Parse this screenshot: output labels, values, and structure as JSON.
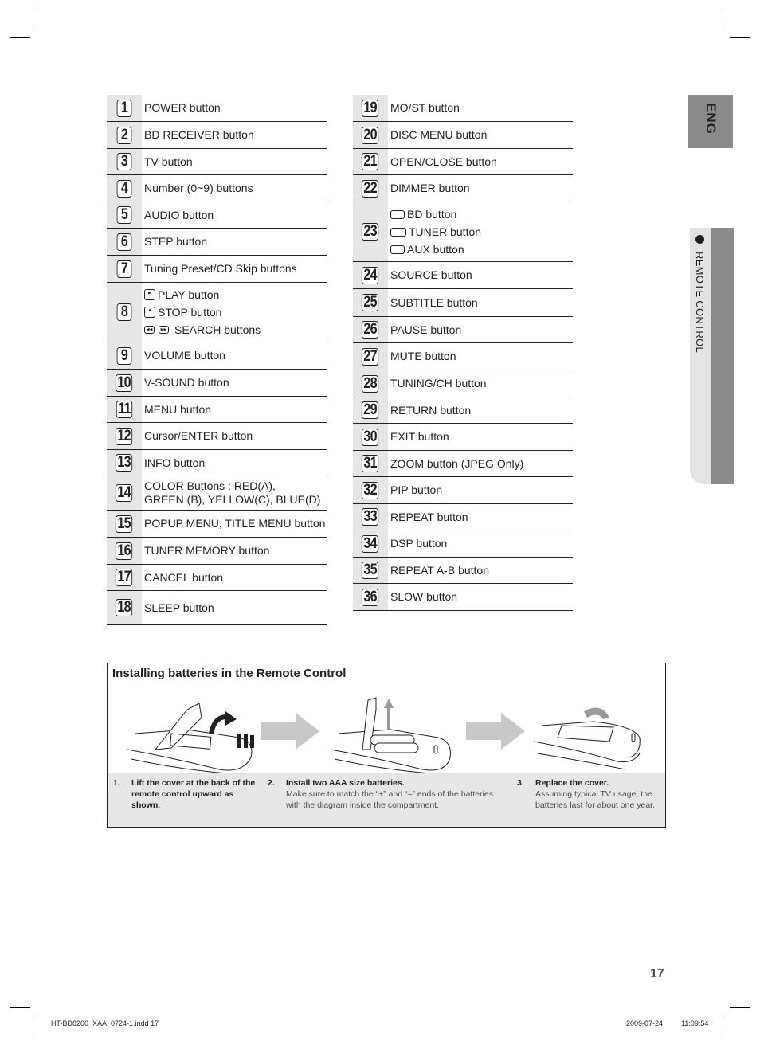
{
  "side_tabs": {
    "language": "ENG",
    "section": "REMOTE CONTROL"
  },
  "left_table": [
    {
      "num": "1",
      "lines": [
        "POWER button"
      ]
    },
    {
      "num": "2",
      "lines": [
        "BD RECEIVER button"
      ]
    },
    {
      "num": "3",
      "lines": [
        "TV button"
      ]
    },
    {
      "num": "4",
      "lines": [
        "Number (0~9) buttons"
      ]
    },
    {
      "num": "5",
      "lines": [
        "AUDIO button"
      ]
    },
    {
      "num": "6",
      "lines": [
        "STEP button"
      ]
    },
    {
      "num": "7",
      "lines": [
        "Tuning Preset/CD Skip buttons"
      ]
    },
    {
      "num": "8",
      "lines": [
        "PLAY button",
        "STOP button",
        "SEARCH buttons"
      ],
      "icons": [
        "play-icon",
        "stop-icon",
        "search-icon"
      ]
    },
    {
      "num": "9",
      "lines": [
        "VOLUME button"
      ]
    },
    {
      "num": "10",
      "lines": [
        "V-SOUND button"
      ]
    },
    {
      "num": "11",
      "lines": [
        "MENU button"
      ]
    },
    {
      "num": "12",
      "lines": [
        "Cursor/ENTER button"
      ]
    },
    {
      "num": "13",
      "lines": [
        "INFO button"
      ]
    },
    {
      "num": "14",
      "lines": [
        "COLOR Buttons : RED(A),",
        "GREEN (B), YELLOW(C), BLUE(D)"
      ]
    },
    {
      "num": "15",
      "lines": [
        "POPUP MENU, TITLE MENU button"
      ]
    },
    {
      "num": "16",
      "lines": [
        "TUNER MEMORY button"
      ]
    },
    {
      "num": "17",
      "lines": [
        "CANCEL button"
      ]
    },
    {
      "num": "18",
      "lines": [
        "SLEEP button"
      ]
    }
  ],
  "right_table": [
    {
      "num": "19",
      "lines": [
        "MO/ST button"
      ]
    },
    {
      "num": "20",
      "lines": [
        "DISC MENU button"
      ]
    },
    {
      "num": "21",
      "lines": [
        "OPEN/CLOSE button"
      ]
    },
    {
      "num": "22",
      "lines": [
        "DIMMER button"
      ]
    },
    {
      "num": "23",
      "lines": [
        "BD button",
        "TUNER button",
        "AUX button"
      ],
      "icons": [
        "bd-icon",
        "tuner-icon",
        "aux-icon"
      ]
    },
    {
      "num": "24",
      "lines": [
        "SOURCE button"
      ]
    },
    {
      "num": "25",
      "lines": [
        "SUBTITLE button"
      ]
    },
    {
      "num": "26",
      "lines": [
        "PAUSE button"
      ]
    },
    {
      "num": "27",
      "lines": [
        "MUTE button"
      ]
    },
    {
      "num": "28",
      "lines": [
        "TUNING/CH button"
      ]
    },
    {
      "num": "29",
      "lines": [
        "RETURN button"
      ]
    },
    {
      "num": "30",
      "lines": [
        "EXIT button"
      ]
    },
    {
      "num": "31",
      "lines": [
        "ZOOM button (JPEG Only)"
      ]
    },
    {
      "num": "32",
      "lines": [
        "PIP button"
      ]
    },
    {
      "num": "33",
      "lines": [
        "REPEAT button"
      ]
    },
    {
      "num": "34",
      "lines": [
        "DSP button"
      ]
    },
    {
      "num": "35",
      "lines": [
        "REPEAT A-B button"
      ]
    },
    {
      "num": "36",
      "lines": [
        "SLOW button"
      ]
    }
  ],
  "icon_labels": {
    "play": "PLAY",
    "stop": "STOP",
    "bd": "BD",
    "tuner": "TUNER",
    "aux": "AUX"
  },
  "batteries": {
    "title": "Installing batteries in the Remote Control",
    "steps": [
      {
        "n": "1.",
        "title": "Lift the cover at the back of the remote control upward as shown.",
        "desc": ""
      },
      {
        "n": "2.",
        "title": "Install two AAA size batteries.",
        "desc": "Make sure to match the “+” and “–” ends of the batteries with the diagram inside the compartment."
      },
      {
        "n": "3.",
        "title": "Replace the cover.",
        "desc": "Assuming typical TV usage, the batteries last for about one year."
      }
    ]
  },
  "page_number": "17",
  "footer": {
    "file": "HT-BD8200_XAA_0724-1.indd   17",
    "date": "2009-07-24",
    "time": "11:09:54"
  },
  "colors": {
    "tab_dark": "#8c8b8b",
    "tab_light": "#e3e3e3",
    "num_cell": "#e6e6e6",
    "steps_bg": "#e6e6e6",
    "arrow": "#c8c8c8"
  }
}
